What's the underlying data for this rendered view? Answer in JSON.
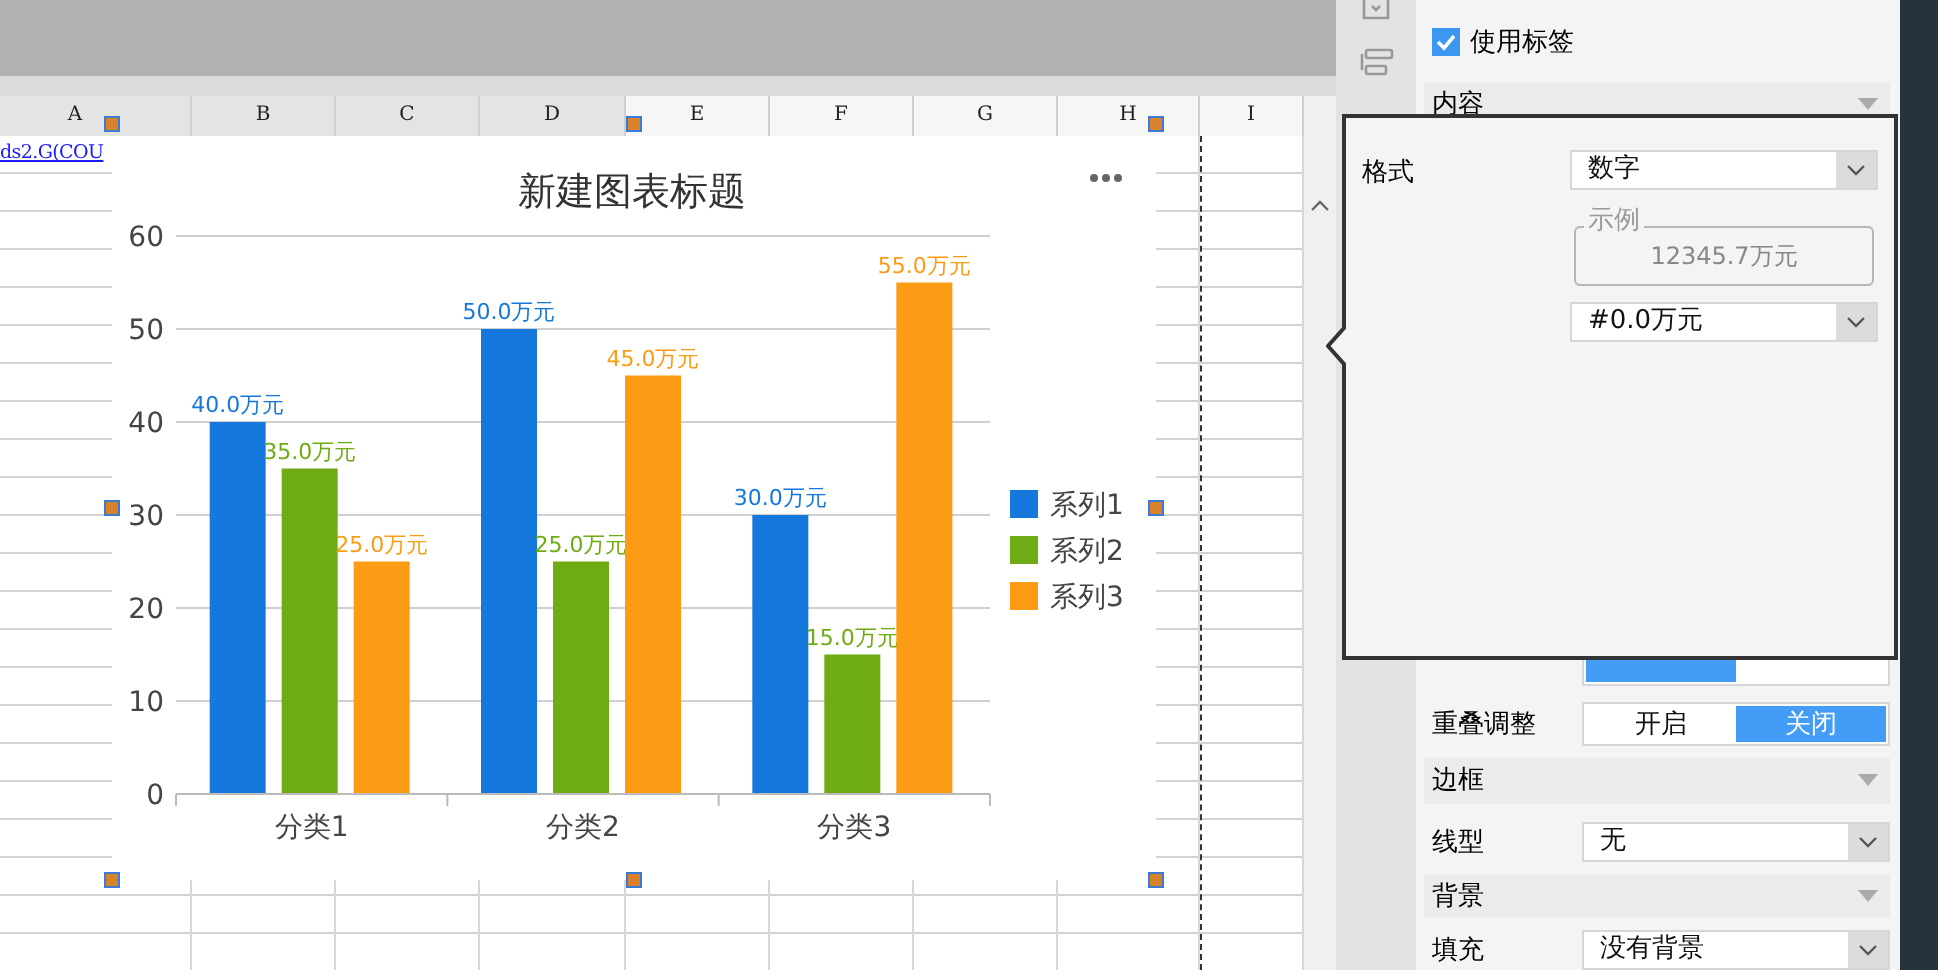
{
  "sheet": {
    "columns": [
      "A",
      "B",
      "C",
      "D",
      "E",
      "F",
      "G",
      "H",
      "I"
    ],
    "cell_a1": "ds2.G(COU"
  },
  "chart": {
    "chart_data": {
      "type": "bar",
      "title": "新建图表标题",
      "categories": [
        "分类1",
        "分类2",
        "分类3"
      ],
      "series": [
        {
          "name": "系列1",
          "color": "#1478dc",
          "values": [
            40,
            50,
            30
          ]
        },
        {
          "name": "系列2",
          "color": "#6fab12",
          "values": [
            35,
            25,
            15
          ]
        },
        {
          "name": "系列3",
          "color": "#fb9c14",
          "values": [
            25,
            45,
            55
          ]
        }
      ],
      "grid": true,
      "legend": true,
      "ylim": [
        0,
        60
      ],
      "yticks": [
        0,
        10,
        20,
        30,
        40,
        50,
        60
      ],
      "value_labels": [
        [
          "40.0万元",
          "50.0万元",
          "30.0万元"
        ],
        [
          "35.0万元",
          "25.0万元",
          "15.0万元"
        ],
        [
          "25.0万元",
          "45.0万元",
          "55.0万元"
        ]
      ]
    }
  },
  "panel": {
    "items": [
      {
        "kind": "checkbox",
        "label": "使用标签",
        "checked": true
      },
      {
        "kind": "section",
        "label": "内容"
      },
      {
        "kind": "segmented",
        "options": [
          {
            "selected": true
          },
          {
            "selected": false
          }
        ]
      },
      {
        "kind": "segmented",
        "label": "重叠调整",
        "options": [
          {
            "label": "开启",
            "selected": false
          },
          {
            "label": "关闭",
            "selected": true
          }
        ]
      },
      {
        "kind": "section",
        "label": "边框"
      },
      {
        "kind": "select",
        "label": "线型",
        "value": "无"
      },
      {
        "kind": "section",
        "label": "背景"
      },
      {
        "kind": "select",
        "label": "填充",
        "value": "没有背景"
      }
    ]
  },
  "popover": {
    "rows": [
      {
        "kind": "select",
        "label": "格式",
        "value": "数字"
      },
      {
        "kind": "sample",
        "legend": "示例",
        "value": "12345.7万元"
      },
      {
        "kind": "select",
        "value": "#0.0万元"
      }
    ]
  }
}
